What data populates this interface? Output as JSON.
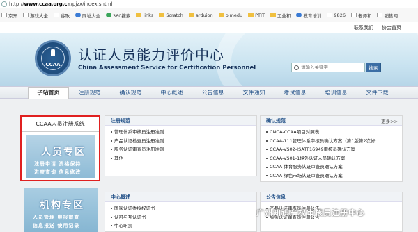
{
  "browser": {
    "url_prefix": "http://",
    "url_domain": "www.ccaa.org.cn",
    "url_path": "/pjzx/index.shtml",
    "bookmarks": [
      {
        "label": "京东",
        "icon": "page-icon"
      },
      {
        "label": "游戏大全",
        "icon": "page-icon"
      },
      {
        "label": "谷歌",
        "icon": "page-icon"
      },
      {
        "label": "网址大全",
        "icon": "globe-icon"
      },
      {
        "label": "360搜索",
        "icon": "search-icon"
      },
      {
        "label": "links",
        "icon": "folder-icon"
      },
      {
        "label": "Scratch",
        "icon": "folder-icon"
      },
      {
        "label": "arduion",
        "icon": "folder-icon"
      },
      {
        "label": "bimedu",
        "icon": "folder-icon"
      },
      {
        "label": "PTIT",
        "icon": "folder-icon"
      },
      {
        "label": "工业和",
        "icon": "folder-icon"
      },
      {
        "label": "教育培训",
        "icon": "globe-icon"
      },
      {
        "label": "9826",
        "icon": "page-icon"
      },
      {
        "label": "老师和",
        "icon": "page-icon"
      },
      {
        "label": "销售网",
        "icon": "page-icon"
      }
    ]
  },
  "top_links": {
    "contact": "联系我们",
    "members": "协会首页"
  },
  "header": {
    "logo_text": "CCAA",
    "title_cn": "认证人员能力评价中心",
    "title_en": "China Assessment Service for Certification Personnel",
    "search_placeholder": "请输入关键字",
    "search_button": "搜索"
  },
  "nav": {
    "items": [
      "子站首页",
      "注册规范",
      "确认规范",
      "中心概述",
      "公告信息",
      "文件通知",
      "考试信息",
      "培训信息",
      "文件下载"
    ]
  },
  "left": {
    "box_title": "CCAA人员注册系统",
    "person_title": "人员专区",
    "person_row1": "注册申请  资格保持",
    "person_row2": "进度查询  信息修改",
    "org_title": "机构专区",
    "org_row1": "人员管理  申报审查",
    "org_row2": "信息报送  使用记录"
  },
  "panels": {
    "reg": {
      "title": "注册规范",
      "items": [
        "管理体系审核员注册准则",
        "产品认证检查员注册准则",
        "服务认证审查员注册准则",
        "其他"
      ]
    },
    "confirm": {
      "title": "确认规范",
      "more": "更多>>",
      "items": [
        "CNCA-CCAA项目对照表",
        "CCAA-111管理体系审核员确认方案（第1版第2次修...",
        "CCAA-VS02-ISATF16949审核员确认方案",
        "CCAA-VS01-1境外认证人员确认方案",
        "CCAA 体育服务认证审查员确认方案",
        "CCAA 绿色市场认证审查员确认方案"
      ]
    },
    "center": {
      "title": "中心概述",
      "items": [
        "国家认证委授权证书",
        "认可与互认证书",
        "中心职责"
      ]
    },
    "notice": {
      "title": "公告信息",
      "items": [
        "产品认证审查员注册公告",
        "服务认证审查员注册公告"
      ]
    }
  },
  "watermark": {
    "text": "广州知识产权审核员注册中心"
  }
}
